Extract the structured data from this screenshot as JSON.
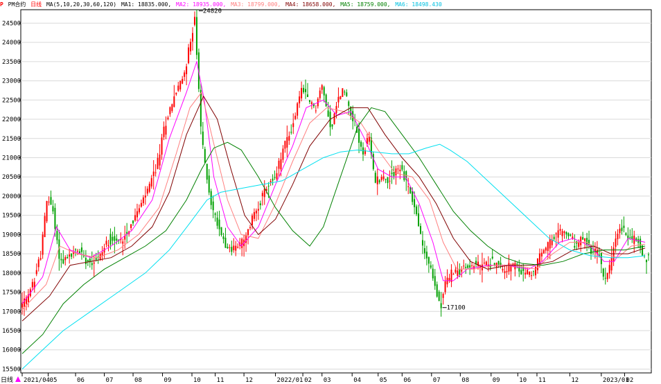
{
  "legend": {
    "symbol": "P",
    "product": "PM合约",
    "period": "日线",
    "ma_params": "MA(5,10,20,30,60,120)",
    "ma1": "MA1: 18835.000,",
    "ma2": "MA2: 18935.000,",
    "ma3": "MA3: 18799.000,",
    "ma4": "MA4: 18658.000,",
    "ma5": "MA5: 18759.000,",
    "ma6": "MA6: 18498.430"
  },
  "bottom_label": "日线",
  "colors": {
    "up": "#ff0000",
    "down": "#00a000",
    "ma1": "#000000",
    "ma2": "#ff00ff",
    "ma3": "#ff8080",
    "ma4": "#800000",
    "ma5": "#008000",
    "ma6": "#00e0f0"
  },
  "chart_data": {
    "type": "candlestick",
    "ylim": [
      15400,
      24850
    ],
    "yticks": [
      15500,
      16000,
      16500,
      17000,
      17500,
      18000,
      18500,
      19000,
      19500,
      20000,
      20500,
      21000,
      21500,
      22000,
      22500,
      23000,
      23500,
      24000,
      24500
    ],
    "x_ticks": [
      {
        "label": "2021/04",
        "t": 0
      },
      {
        "label": "05",
        "t": 38
      },
      {
        "label": "06",
        "t": 78
      },
      {
        "label": "07",
        "t": 120
      },
      {
        "label": "08",
        "t": 162
      },
      {
        "label": "09",
        "t": 205
      },
      {
        "label": "10",
        "t": 248
      },
      {
        "label": "11",
        "t": 282
      },
      {
        "label": "12",
        "t": 324
      },
      {
        "label": "2022/01",
        "t": 370
      },
      {
        "label": "02",
        "t": 410
      },
      {
        "label": "03",
        "t": 438
      },
      {
        "label": "04",
        "t": 482
      },
      {
        "label": "05",
        "t": 520
      },
      {
        "label": "06",
        "t": 555
      },
      {
        "label": "07",
        "t": 598
      },
      {
        "label": "08",
        "t": 640
      },
      {
        "label": "09",
        "t": 685
      },
      {
        "label": "10",
        "t": 724
      },
      {
        "label": "11",
        "t": 752
      },
      {
        "label": "12",
        "t": 800
      },
      {
        "label": "2023/01",
        "t": 846
      },
      {
        "label": "02",
        "t": 880
      }
    ],
    "x_range": [
      0,
      915
    ],
    "price_path": [
      [
        0,
        17150
      ],
      [
        10,
        17300
      ],
      [
        20,
        17800
      ],
      [
        30,
        18500
      ],
      [
        40,
        20000
      ],
      [
        48,
        19600
      ],
      [
        58,
        18300
      ],
      [
        70,
        18400
      ],
      [
        85,
        18600
      ],
      [
        100,
        18300
      ],
      [
        115,
        18400
      ],
      [
        130,
        18900
      ],
      [
        145,
        18800
      ],
      [
        160,
        19200
      ],
      [
        172,
        19600
      ],
      [
        185,
        20100
      ],
      [
        200,
        20800
      ],
      [
        212,
        21900
      ],
      [
        225,
        22600
      ],
      [
        238,
        23100
      ],
      [
        248,
        23900
      ],
      [
        255,
        24700
      ],
      [
        260,
        23000
      ],
      [
        264,
        21800
      ],
      [
        270,
        20800
      ],
      [
        280,
        19700
      ],
      [
        292,
        19100
      ],
      [
        305,
        18600
      ],
      [
        318,
        18700
      ],
      [
        330,
        18900
      ],
      [
        340,
        19500
      ],
      [
        352,
        19900
      ],
      [
        362,
        20300
      ],
      [
        372,
        20400
      ],
      [
        385,
        21300
      ],
      [
        398,
        21800
      ],
      [
        410,
        22800
      ],
      [
        420,
        22500
      ],
      [
        432,
        22300
      ],
      [
        440,
        22900
      ],
      [
        448,
        22300
      ],
      [
        455,
        21700
      ],
      [
        462,
        22400
      ],
      [
        472,
        22800
      ],
      [
        480,
        22400
      ],
      [
        490,
        21800
      ],
      [
        500,
        21100
      ],
      [
        510,
        21500
      ],
      [
        518,
        20400
      ],
      [
        528,
        20500
      ],
      [
        538,
        20400
      ],
      [
        548,
        20700
      ],
      [
        556,
        20700
      ],
      [
        566,
        20300
      ],
      [
        578,
        19600
      ],
      [
        588,
        18700
      ],
      [
        598,
        18200
      ],
      [
        608,
        17500
      ],
      [
        614,
        17150
      ],
      [
        622,
        17800
      ],
      [
        632,
        18000
      ],
      [
        645,
        18100
      ],
      [
        660,
        18200
      ],
      [
        675,
        18200
      ],
      [
        690,
        18300
      ],
      [
        705,
        18100
      ],
      [
        720,
        18200
      ],
      [
        735,
        18000
      ],
      [
        750,
        18000
      ],
      [
        760,
        18500
      ],
      [
        775,
        18800
      ],
      [
        790,
        19100
      ],
      [
        800,
        19000
      ],
      [
        812,
        18700
      ],
      [
        822,
        18900
      ],
      [
        834,
        18600
      ],
      [
        846,
        18500
      ],
      [
        852,
        17800
      ],
      [
        860,
        18100
      ],
      [
        868,
        18700
      ],
      [
        876,
        19200
      ],
      [
        886,
        19000
      ],
      [
        896,
        18900
      ],
      [
        904,
        18800
      ],
      [
        910,
        18400
      ]
    ],
    "ma_lines": [
      {
        "key": "ma2",
        "points": [
          [
            0,
            17200
          ],
          [
            30,
            17900
          ],
          [
            50,
            19200
          ],
          [
            70,
            18600
          ],
          [
            100,
            18400
          ],
          [
            130,
            18700
          ],
          [
            160,
            19100
          ],
          [
            190,
            19900
          ],
          [
            215,
            21500
          ],
          [
            240,
            22700
          ],
          [
            255,
            23500
          ],
          [
            266,
            22500
          ],
          [
            280,
            20500
          ],
          [
            300,
            19200
          ],
          [
            320,
            18700
          ],
          [
            345,
            19200
          ],
          [
            370,
            20300
          ],
          [
            395,
            21300
          ],
          [
            415,
            22300
          ],
          [
            440,
            22500
          ],
          [
            460,
            22100
          ],
          [
            480,
            22200
          ],
          [
            500,
            21500
          ],
          [
            520,
            20700
          ],
          [
            540,
            20500
          ],
          [
            560,
            20500
          ],
          [
            580,
            19800
          ],
          [
            600,
            18800
          ],
          [
            615,
            17800
          ],
          [
            630,
            17800
          ],
          [
            650,
            18100
          ],
          [
            680,
            18200
          ],
          [
            710,
            18200
          ],
          [
            740,
            18100
          ],
          [
            760,
            18300
          ],
          [
            785,
            18800
          ],
          [
            805,
            18900
          ],
          [
            830,
            18700
          ],
          [
            850,
            18300
          ],
          [
            865,
            18300
          ],
          [
            885,
            18900
          ],
          [
            910,
            18800
          ]
        ]
      },
      {
        "key": "ma3",
        "points": [
          [
            0,
            17050
          ],
          [
            35,
            17700
          ],
          [
            55,
            18700
          ],
          [
            80,
            18500
          ],
          [
            110,
            18400
          ],
          [
            140,
            18600
          ],
          [
            170,
            19000
          ],
          [
            200,
            19700
          ],
          [
            225,
            21100
          ],
          [
            245,
            22300
          ],
          [
            262,
            22700
          ],
          [
            278,
            21500
          ],
          [
            300,
            19900
          ],
          [
            320,
            19000
          ],
          [
            345,
            18900
          ],
          [
            370,
            19800
          ],
          [
            395,
            20900
          ],
          [
            420,
            21900
          ],
          [
            445,
            22300
          ],
          [
            470,
            22200
          ],
          [
            495,
            21900
          ],
          [
            520,
            21200
          ],
          [
            545,
            20600
          ],
          [
            570,
            20500
          ],
          [
            595,
            19900
          ],
          [
            615,
            18800
          ],
          [
            635,
            18100
          ],
          [
            660,
            18100
          ],
          [
            690,
            18200
          ],
          [
            720,
            18200
          ],
          [
            750,
            18100
          ],
          [
            775,
            18500
          ],
          [
            800,
            18800
          ],
          [
            825,
            18800
          ],
          [
            850,
            18500
          ],
          [
            870,
            18400
          ],
          [
            890,
            18700
          ],
          [
            910,
            18750
          ]
        ]
      },
      {
        "key": "ma4",
        "points": [
          [
            0,
            16750
          ],
          [
            40,
            17400
          ],
          [
            70,
            18200
          ],
          [
            100,
            18300
          ],
          [
            130,
            18400
          ],
          [
            160,
            18700
          ],
          [
            190,
            19200
          ],
          [
            215,
            20100
          ],
          [
            240,
            21600
          ],
          [
            265,
            22600
          ],
          [
            285,
            22000
          ],
          [
            305,
            20700
          ],
          [
            325,
            19500
          ],
          [
            345,
            19000
          ],
          [
            370,
            19400
          ],
          [
            395,
            20300
          ],
          [
            420,
            21300
          ],
          [
            450,
            22000
          ],
          [
            480,
            22300
          ],
          [
            505,
            22300
          ],
          [
            530,
            21600
          ],
          [
            555,
            21000
          ],
          [
            580,
            20500
          ],
          [
            605,
            19800
          ],
          [
            630,
            18900
          ],
          [
            655,
            18300
          ],
          [
            680,
            18100
          ],
          [
            710,
            18200
          ],
          [
            745,
            18200
          ],
          [
            775,
            18300
          ],
          [
            805,
            18600
          ],
          [
            835,
            18700
          ],
          [
            860,
            18500
          ],
          [
            885,
            18500
          ],
          [
            910,
            18650
          ]
        ]
      },
      {
        "key": "ma5",
        "points": [
          [
            0,
            15900
          ],
          [
            30,
            16400
          ],
          [
            60,
            17200
          ],
          [
            90,
            17700
          ],
          [
            120,
            18100
          ],
          [
            150,
            18400
          ],
          [
            180,
            18700
          ],
          [
            210,
            19100
          ],
          [
            240,
            19900
          ],
          [
            262,
            20700
          ],
          [
            280,
            21250
          ],
          [
            300,
            21400
          ],
          [
            320,
            21200
          ],
          [
            345,
            20500
          ],
          [
            370,
            19700
          ],
          [
            395,
            19100
          ],
          [
            420,
            18700
          ],
          [
            440,
            19200
          ],
          [
            465,
            20500
          ],
          [
            490,
            21800
          ],
          [
            510,
            22300
          ],
          [
            530,
            22200
          ],
          [
            555,
            21600
          ],
          [
            580,
            21000
          ],
          [
            605,
            20300
          ],
          [
            630,
            19600
          ],
          [
            655,
            19100
          ],
          [
            680,
            18700
          ],
          [
            705,
            18400
          ],
          [
            730,
            18250
          ],
          [
            760,
            18200
          ],
          [
            790,
            18300
          ],
          [
            820,
            18500
          ],
          [
            850,
            18600
          ],
          [
            880,
            18600
          ],
          [
            910,
            18700
          ]
        ]
      },
      {
        "key": "ma6",
        "points": [
          [
            0,
            15500
          ],
          [
            30,
            16000
          ],
          [
            60,
            16500
          ],
          [
            100,
            17000
          ],
          [
            140,
            17500
          ],
          [
            180,
            18000
          ],
          [
            215,
            18600
          ],
          [
            245,
            19300
          ],
          [
            270,
            19900
          ],
          [
            290,
            20100
          ],
          [
            320,
            20200
          ],
          [
            350,
            20300
          ],
          [
            380,
            20400
          ],
          [
            410,
            20700
          ],
          [
            440,
            21000
          ],
          [
            465,
            21150
          ],
          [
            490,
            21200
          ],
          [
            515,
            21150
          ],
          [
            540,
            21100
          ],
          [
            565,
            21100
          ],
          [
            590,
            21250
          ],
          [
            610,
            21350
          ],
          [
            625,
            21200
          ],
          [
            650,
            20900
          ],
          [
            680,
            20400
          ],
          [
            710,
            19900
          ],
          [
            740,
            19400
          ],
          [
            770,
            18900
          ],
          [
            800,
            18600
          ],
          [
            830,
            18450
          ],
          [
            860,
            18400
          ],
          [
            885,
            18400
          ],
          [
            910,
            18450
          ]
        ]
      }
    ],
    "annotations": [
      {
        "text": "24820",
        "t": 258,
        "value": 24820
      },
      {
        "text": "17100",
        "t": 614,
        "value": 17100
      }
    ]
  }
}
